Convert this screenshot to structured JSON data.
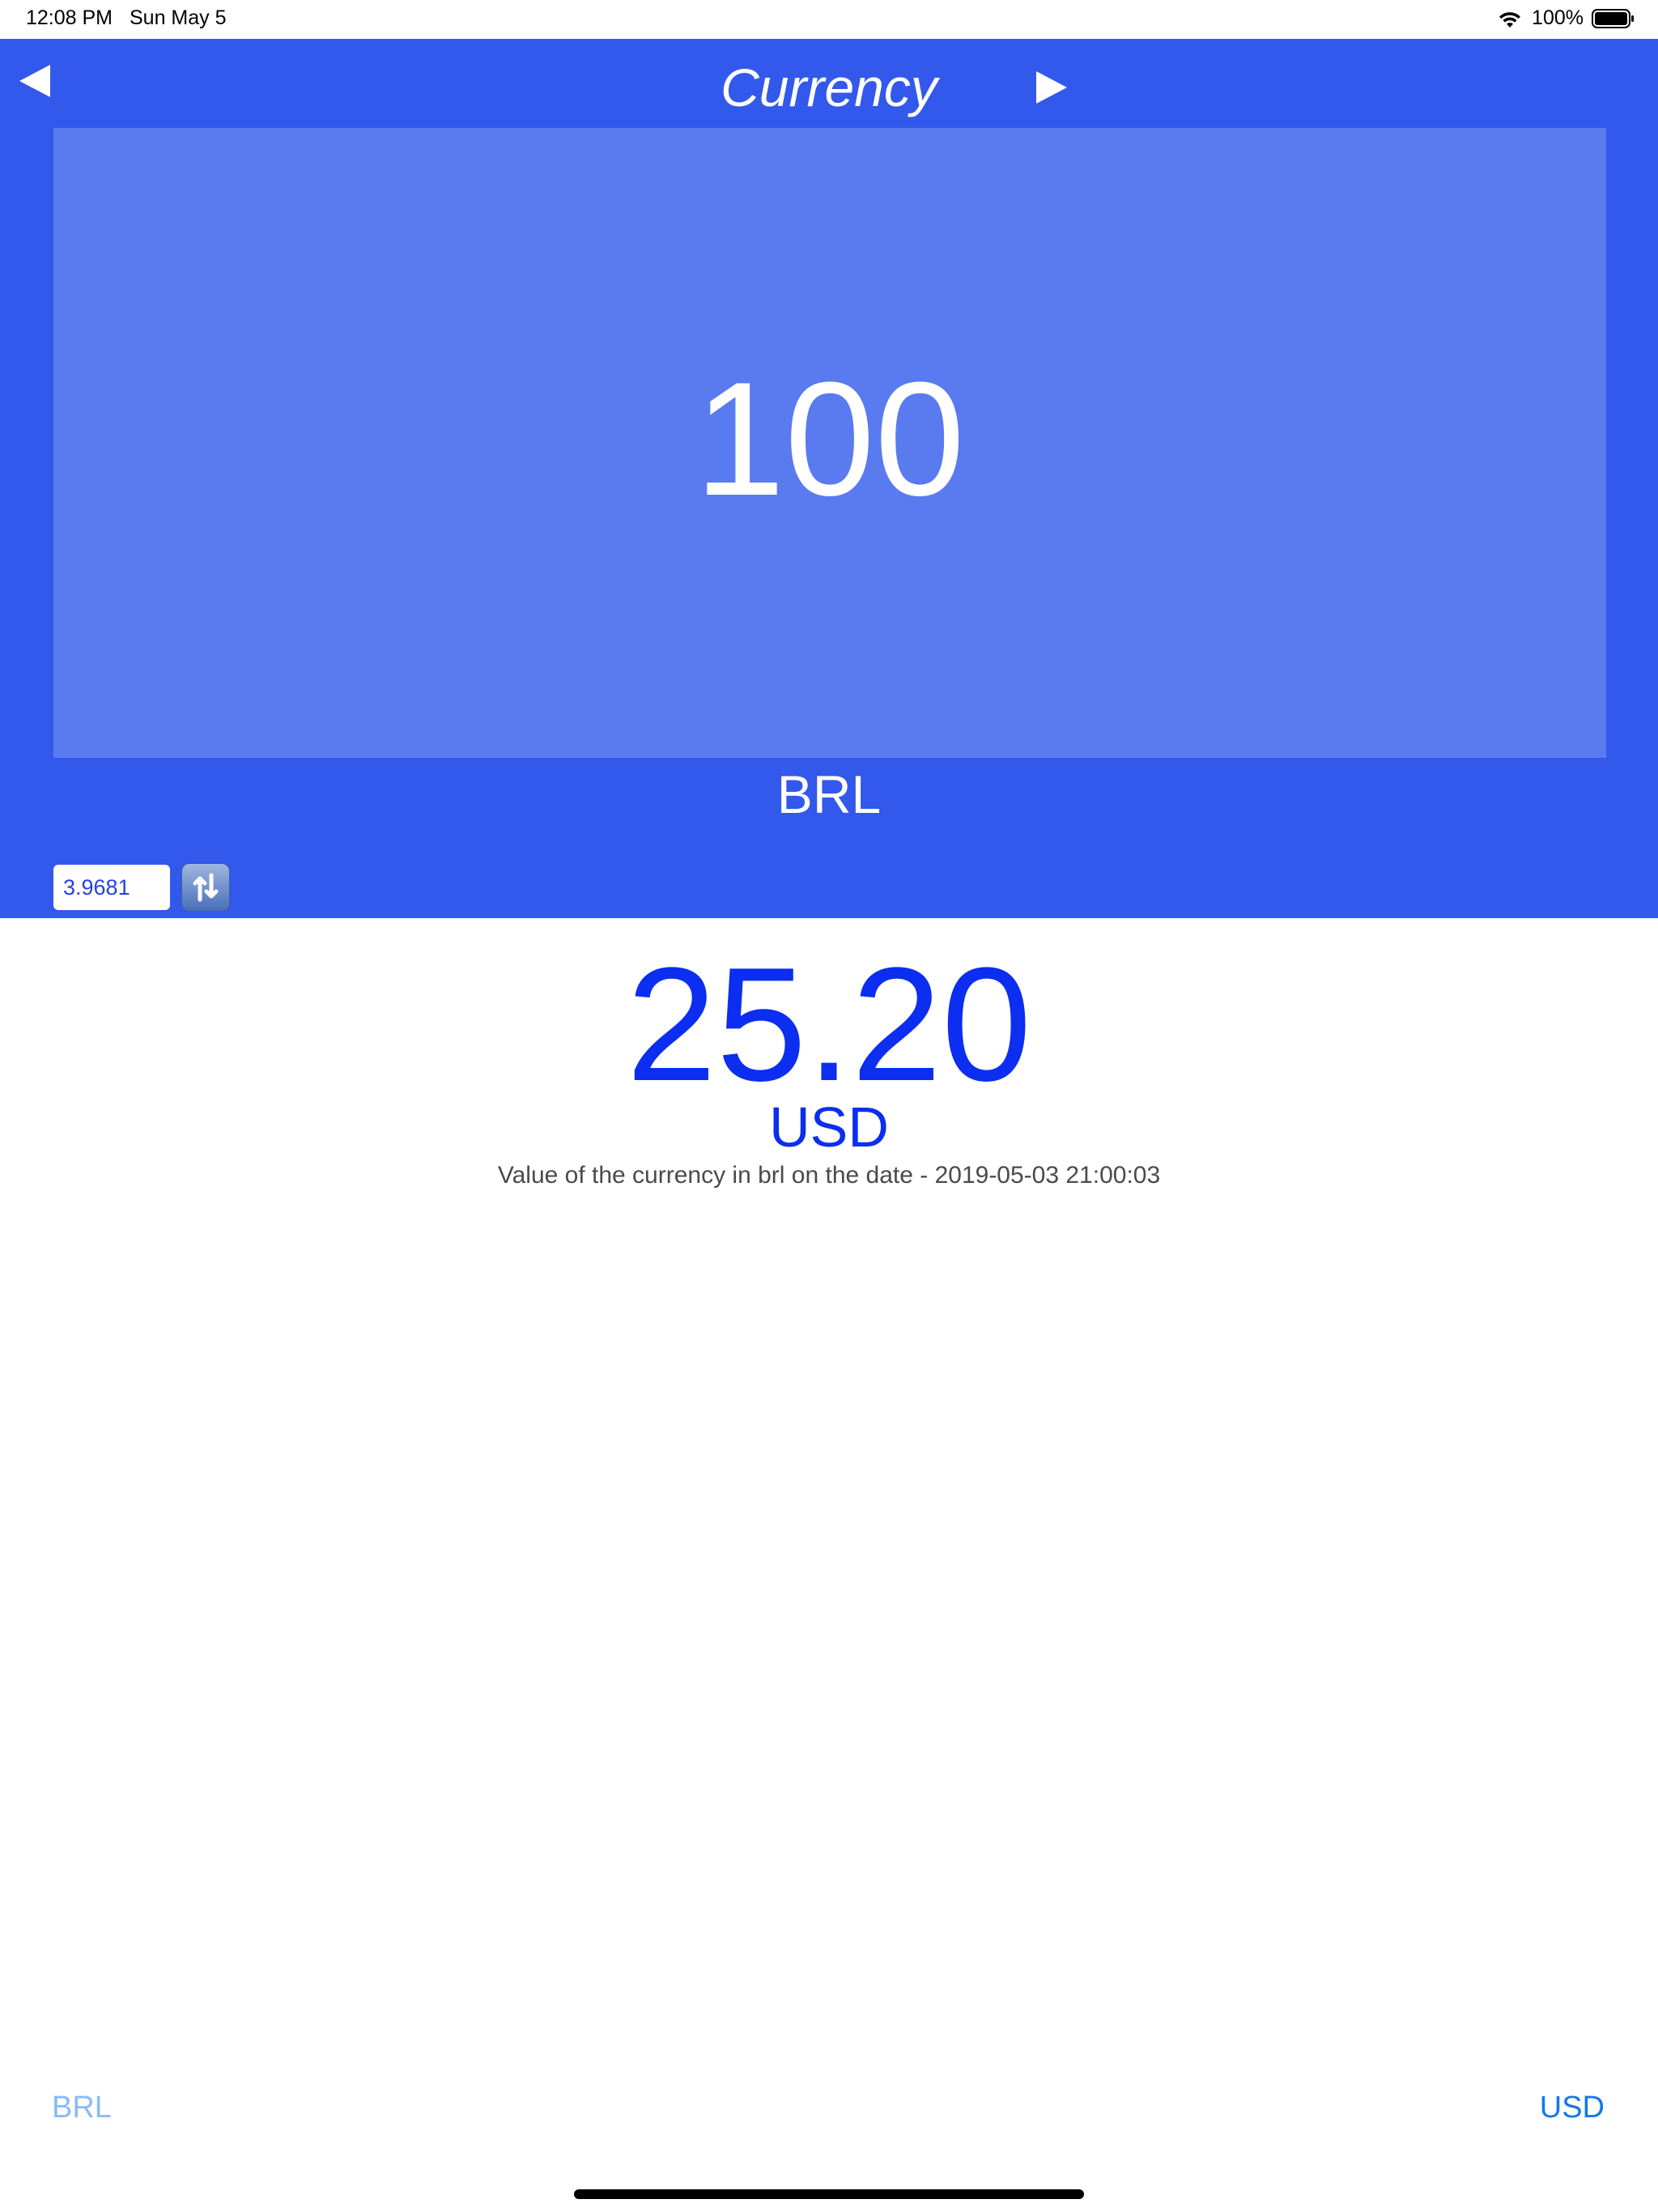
{
  "status_bar": {
    "time": "12:08 PM",
    "date": "Sun May 5",
    "battery": "100%"
  },
  "header": {
    "title": "Currency",
    "back_icon": "left-triangle-icon",
    "forward_icon": "right-triangle-icon"
  },
  "converter": {
    "amount": "100",
    "from_currency": "BRL",
    "rate": "3.9681",
    "swap_icon": "swap-arrows-icon",
    "result": "25.20",
    "to_currency": "USD",
    "info": "Value of the currency in brl on the date - 2019-05-03 21:00:03"
  },
  "footer": {
    "from_label": "BRL",
    "to_label": "USD"
  },
  "colors": {
    "header_background": "#3358ec",
    "amount_box": "#5a7af0",
    "result_text": "#0b2ef0",
    "footer_from": "#8bbaf5",
    "footer_to": "#1577e8"
  }
}
